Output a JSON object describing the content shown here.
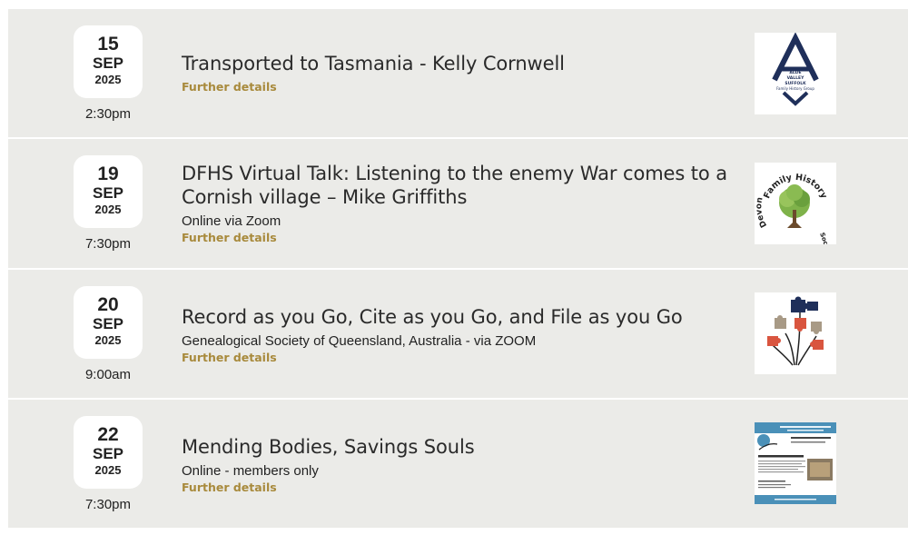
{
  "events": [
    {
      "day": "15",
      "month": "SEP",
      "year": "2025",
      "time": "2:30pm",
      "title": "Transported to Tasmania - Kelly Cornwell",
      "subtitle": "",
      "details_label": "Further details",
      "logo": {
        "name": "alde-valley-logo-icon",
        "lines": [
          "ALDE",
          "VALLEY",
          "SUFFOLK",
          "Family History Group"
        ]
      }
    },
    {
      "day": "19",
      "month": "SEP",
      "year": "2025",
      "time": "7:30pm",
      "title": "DFHS Virtual Talk: Listening to the enemy War comes to a Cornish village – Mike Griffiths",
      "subtitle": "Online via Zoom",
      "details_label": "Further details",
      "logo": {
        "name": "devon-fhs-tree-logo-icon",
        "lines": [
          "Devon",
          "Family History",
          "Society"
        ]
      }
    },
    {
      "day": "20",
      "month": "SEP",
      "year": "2025",
      "time": "9:00am",
      "title": "Record as you Go, Cite as you Go, and File as you Go",
      "subtitle": "Genealogical Society of Queensland, Australia - via ZOOM",
      "details_label": "Further details",
      "logo": {
        "name": "puzzle-pieces-logo-icon",
        "lines": []
      }
    },
    {
      "day": "22",
      "month": "SEP",
      "year": "2025",
      "time": "7:30pm",
      "title": "Mending Bodies, Savings Souls",
      "subtitle": "Online - members only",
      "details_label": "Further details",
      "logo": {
        "name": "event-flyer-thumbnail-icon",
        "lines": []
      }
    }
  ],
  "colors": {
    "row_bg": "#ebebe8",
    "details": "#a88a3c",
    "logo_navy": "#1f2f5a",
    "puzzle_red": "#d9553f",
    "puzzle_tan": "#a89a86",
    "flyer_blue": "#4a90b8"
  }
}
